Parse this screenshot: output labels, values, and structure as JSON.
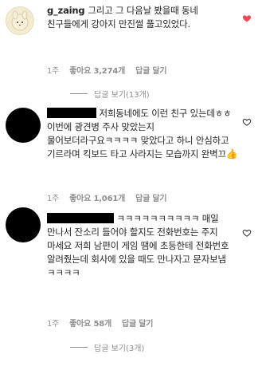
{
  "comments": [
    {
      "username": "g_zaing",
      "text": "그리고 그 다음날 봤을때 동네 친구들에게 강아지 만진썰 풀고있었다.",
      "time": "1주",
      "likes": "좋아요 3,274개",
      "reply": "답글 달기",
      "view_replies": "답글 보기(13개)",
      "liked": true
    },
    {
      "username": "",
      "text": "저희동네에도 이런 친구 있는데ㅎㅎ 이번에 광견병 주사 맞았는지 물어보더라구요ㅋㅋㅋㅋ 맞았다고 하니 안심하고 기르라며 킥보드 타고 사라지는 모습까지 완벽끄",
      "emoji": "👍",
      "time": "1주",
      "likes": "좋아요 1,061개",
      "reply": "답글 달기",
      "liked": false
    },
    {
      "username": "",
      "text": "ㅋㅋㅋㅋㅋㅋㅋㅋㅋㅋ 매일 만나서 잔소리 들어야 할지도 전화번호는 주지 마세요 저희 남편이 게임 땜에 초등한테 전화번호 알려줬는데 회사에 있을 때도 만나자고 문자보냄 ㅋㅋㅋㅋ",
      "time": "1주",
      "likes": "좋아요 58개",
      "reply": "답글 달기",
      "view_replies": "답글 보기(3개)",
      "liked": false
    }
  ],
  "colors": {
    "heart_liked": "#ed4956",
    "meta": "#8e8e8e"
  },
  "icons": {
    "heart": "heart-icon",
    "thumbs": "thumbs-up-emoji"
  }
}
